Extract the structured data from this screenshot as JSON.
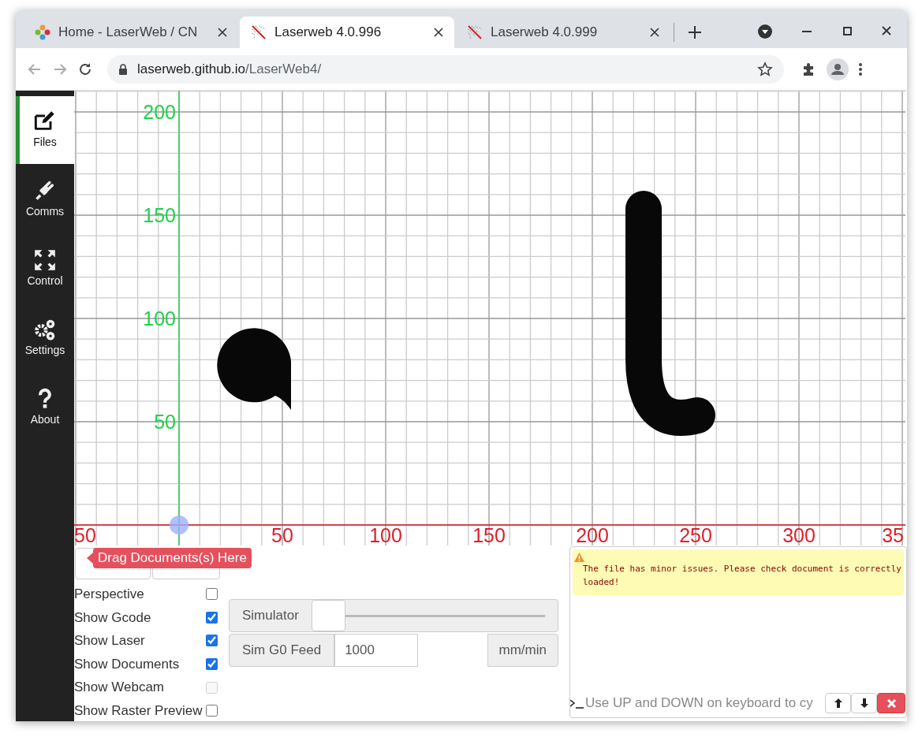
{
  "browser": {
    "tabs": [
      {
        "title": "Home - LaserWeb / CN",
        "selected": false,
        "kind": "home"
      },
      {
        "title": "Laserweb 4.0.996",
        "selected": true,
        "kind": "laser"
      },
      {
        "title": "Laserweb 4.0.999",
        "selected": false,
        "kind": "laser"
      }
    ],
    "address": {
      "host": "laserweb.github.io",
      "path": "/LaserWeb4/"
    }
  },
  "sidebar": {
    "items": [
      {
        "label": "Files",
        "selected": true
      },
      {
        "label": "Comms",
        "selected": false
      },
      {
        "label": "Control",
        "selected": false
      },
      {
        "label": "Settings",
        "selected": false
      },
      {
        "label": "About",
        "selected": false
      }
    ]
  },
  "workspace": {
    "x_labels": [
      "50",
      "50",
      "100",
      "150",
      "200",
      "250",
      "300",
      "35"
    ],
    "y_labels": [
      "200",
      "150",
      "100",
      "50"
    ]
  },
  "tooltip": "Drag Documents(s) Here",
  "options": [
    {
      "label": "Perspective",
      "checked": false,
      "disabled": false
    },
    {
      "label": "Show Gcode",
      "checked": true,
      "disabled": false
    },
    {
      "label": "Show Laser",
      "checked": true,
      "disabled": false
    },
    {
      "label": "Show Documents",
      "checked": true,
      "disabled": false
    },
    {
      "label": "Show Webcam",
      "checked": false,
      "disabled": true
    },
    {
      "label": "Show Raster Preview",
      "checked": false,
      "disabled": false
    }
  ],
  "simulator": {
    "label": "Simulator",
    "level": 0
  },
  "feed": {
    "label": "Sim G0 Feed",
    "value": "1000",
    "unit": "mm/min"
  },
  "console": {
    "messages": [
      {
        "kind": "warning",
        "text": "The file has minor issues. Please check document is correctly loaded!"
      }
    ],
    "placeholder": "Use UP and DOWN on keyboard to cy"
  }
}
